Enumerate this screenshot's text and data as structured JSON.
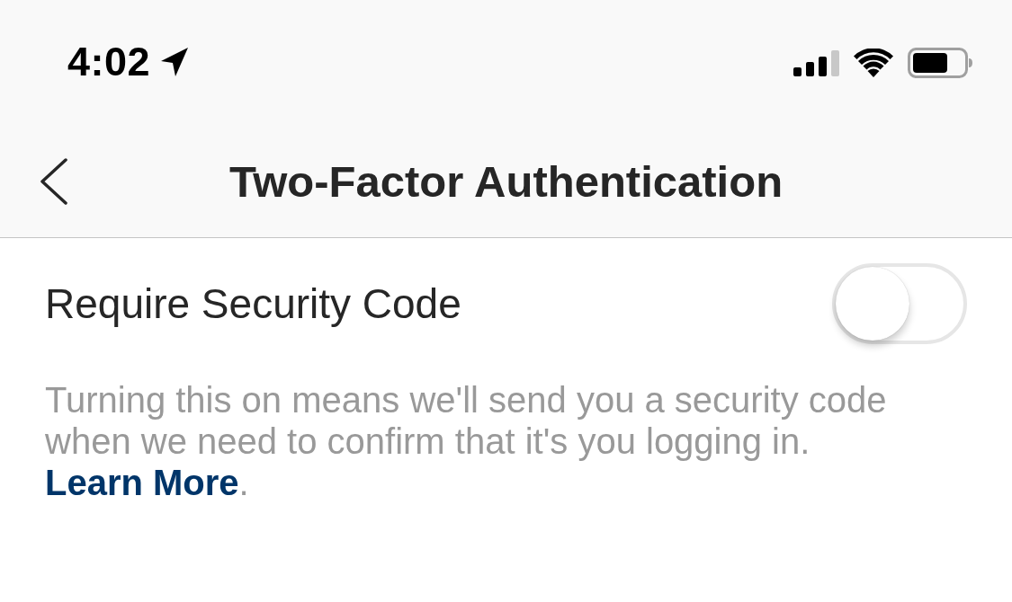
{
  "status_bar": {
    "time": "4:02"
  },
  "nav_bar": {
    "title": "Two-Factor Authentication"
  },
  "setting": {
    "label": "Require Security Code",
    "on": false
  },
  "description": {
    "text": "Turning this on means we'll send you a security code when we need to confirm that it's you logging in.",
    "link": "Learn More",
    "after_link": "."
  }
}
